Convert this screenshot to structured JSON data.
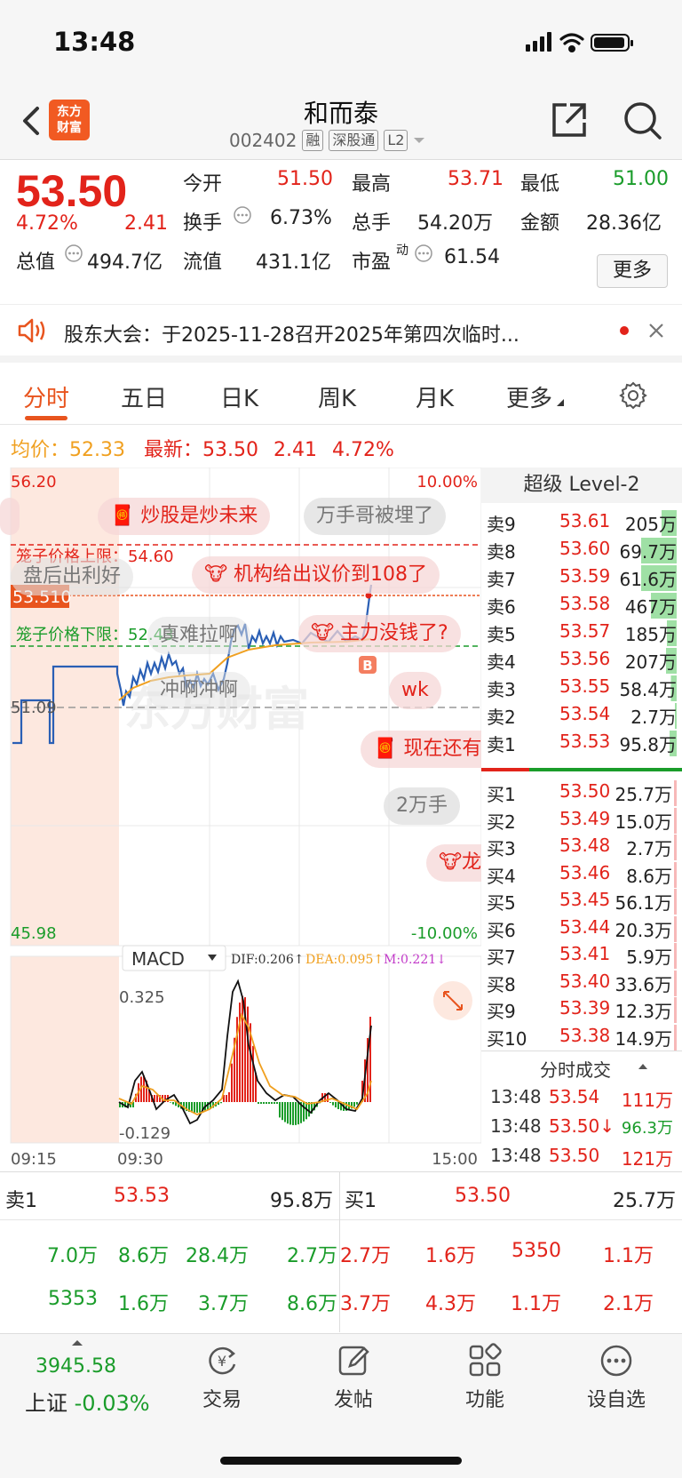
{
  "status": {
    "time": "13:48"
  },
  "nav": {
    "logo_line1": "东方",
    "logo_line2": "财富",
    "stock_name": "和而泰",
    "code": "002402",
    "tag1": "融",
    "tag2": "深股通",
    "tag3": "L2"
  },
  "quote": {
    "price": "53.50",
    "change_pct": "4.72%",
    "change": "2.41",
    "open_label": "今开",
    "open": "51.50",
    "high_label": "最高",
    "high": "53.71",
    "low_label": "最低",
    "low": "51.00",
    "turnover_label": "换手",
    "turnover": "6.73%",
    "volume_label": "总手",
    "volume": "54.20万",
    "amount_label": "金额",
    "amount": "28.36亿",
    "mktcap_label": "总值",
    "mktcap": "494.7亿",
    "float_label": "流值",
    "float": "431.1亿",
    "pe_label": "市盈",
    "pe_sup": "动",
    "pe": "61.54",
    "more": "更多"
  },
  "notice": {
    "text": "股东大会：于2025-11-28召开2025年第四次临时..."
  },
  "tabs": [
    "分时",
    "五日",
    "日K",
    "周K",
    "月K",
    "更多"
  ],
  "avgline": {
    "avg_label": "均价：",
    "avg": "52.33",
    "latest_label": "最新：",
    "latest": "53.50",
    "chg": "2.41",
    "pct": "4.72%"
  },
  "chart": {
    "ymax": "56.20",
    "ymin": "45.98",
    "pct_max": "10.00%",
    "pct_min": "-10.00%",
    "upper_limit": "笼子价格上限：54.60",
    "lower_limit": "笼子价格下限：52.43",
    "last_price_tag": "53.510",
    "prev_close": "51.09",
    "buy_marker": "B",
    "watermark": "东方财富",
    "macd": {
      "label": "MACD",
      "dif": "DIF:0.206↑",
      "dea": "DEA:0.095↑",
      "m": "M:0.221↓",
      "max": "0.325",
      "min": "-0.129"
    },
    "times": [
      "09:15",
      "09:30",
      "15:00"
    ]
  },
  "danmu": [
    "炒股是炒未来",
    "万手哥被埋了",
    "盘后出利好",
    "机构给出议价到108了",
    "真难拉啊",
    "主力没钱了?",
    "冲啊冲啊",
    "wk",
    "现在还有",
    "2万手",
    "龙"
  ],
  "level2": {
    "title": "超级 Level-2",
    "asks": [
      [
        "卖9",
        "53.61",
        "205万"
      ],
      [
        "卖8",
        "53.60",
        "69.7万"
      ],
      [
        "卖7",
        "53.59",
        "61.6万"
      ],
      [
        "卖6",
        "53.58",
        "467万"
      ],
      [
        "卖5",
        "53.57",
        "185万"
      ],
      [
        "卖4",
        "53.56",
        "207万"
      ],
      [
        "卖3",
        "53.55",
        "58.4万"
      ],
      [
        "卖2",
        "53.54",
        "2.7万"
      ],
      [
        "卖1",
        "53.53",
        "95.8万"
      ]
    ],
    "bids": [
      [
        "买1",
        "53.50",
        "25.7万"
      ],
      [
        "买2",
        "53.49",
        "15.0万"
      ],
      [
        "买3",
        "53.48",
        "2.7万"
      ],
      [
        "买4",
        "53.46",
        "8.6万"
      ],
      [
        "买5",
        "53.45",
        "56.1万"
      ],
      [
        "买6",
        "53.44",
        "20.3万"
      ],
      [
        "买7",
        "53.41",
        "5.9万"
      ],
      [
        "买8",
        "53.40",
        "33.6万"
      ],
      [
        "买9",
        "53.39",
        "12.3万"
      ],
      [
        "买10",
        "53.38",
        "14.9万"
      ]
    ],
    "trades_title": "分时成交",
    "trades": [
      [
        "13:48",
        "53.54",
        "111万"
      ],
      [
        "13:48",
        "53.50↓",
        "96.3万"
      ],
      [
        "13:48",
        "53.50",
        "121万"
      ]
    ]
  },
  "queue": {
    "sell_label": "卖1",
    "sell_price": "53.53",
    "sell_vol": "95.8万",
    "buy_label": "买1",
    "buy_price": "53.50",
    "buy_vol": "25.7万",
    "sell_orders": [
      [
        "7.0万",
        "8.6万",
        "28.4万",
        "2.7万"
      ],
      [
        "5353",
        "1.6万",
        "3.7万",
        "8.6万"
      ]
    ],
    "buy_orders": [
      [
        "2.7万",
        "1.6万",
        "5350",
        "1.1万"
      ],
      [
        "3.7万",
        "4.3万",
        "1.1万",
        "2.1万"
      ]
    ]
  },
  "bottom": {
    "index_value": "3945.58",
    "index_name": "上证",
    "index_pct": "-0.03%",
    "items": [
      "交易",
      "发帖",
      "功能",
      "设自选"
    ]
  }
}
